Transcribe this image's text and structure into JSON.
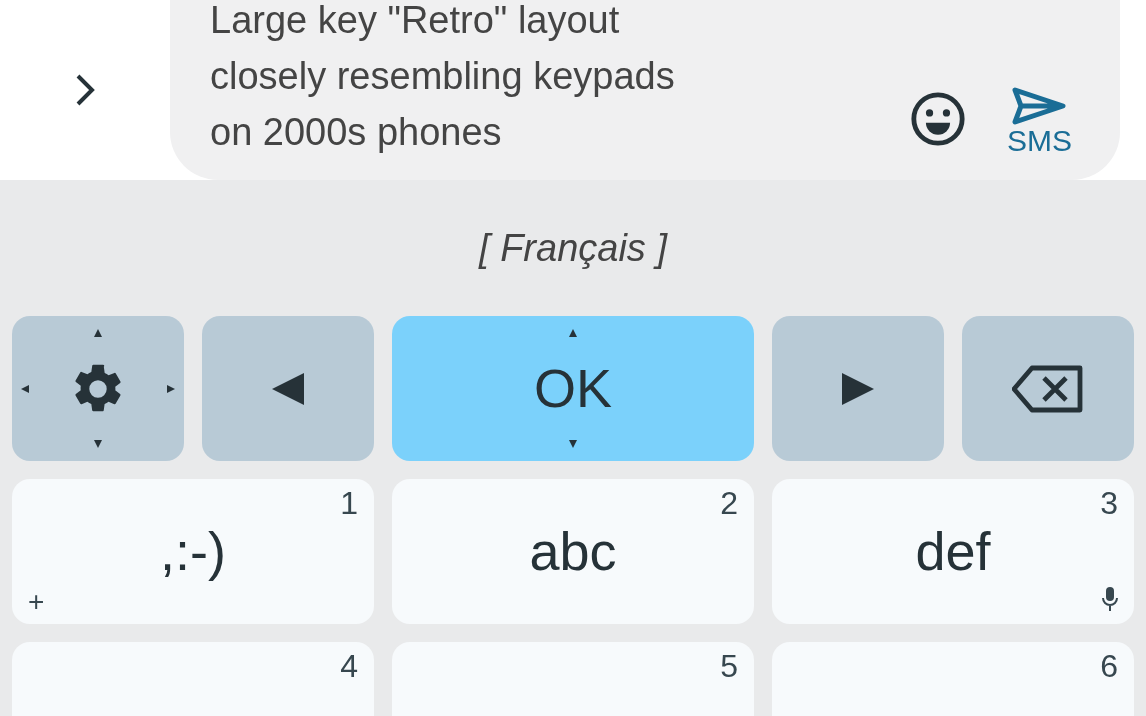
{
  "message": {
    "lines": [
      "Large key \"Retro\" layout",
      "closely resembling keypads",
      "on 2000s phones"
    ],
    "send_label": "SMS"
  },
  "language": "[ Français ]",
  "nav_keys": [
    {
      "kind": "settings",
      "highlighted": false
    },
    {
      "kind": "left",
      "highlighted": false
    },
    {
      "kind": "ok",
      "label": "OK",
      "highlighted": true
    },
    {
      "kind": "right",
      "highlighted": false
    },
    {
      "kind": "backspace",
      "highlighted": false
    }
  ],
  "digit_keys": [
    {
      "digit": "1",
      "label": ",:-)",
      "corner": "+"
    },
    {
      "digit": "2",
      "label": "abc"
    },
    {
      "digit": "3",
      "label": "def",
      "mic": true
    },
    {
      "digit": "4"
    },
    {
      "digit": "5"
    },
    {
      "digit": "6"
    }
  ]
}
